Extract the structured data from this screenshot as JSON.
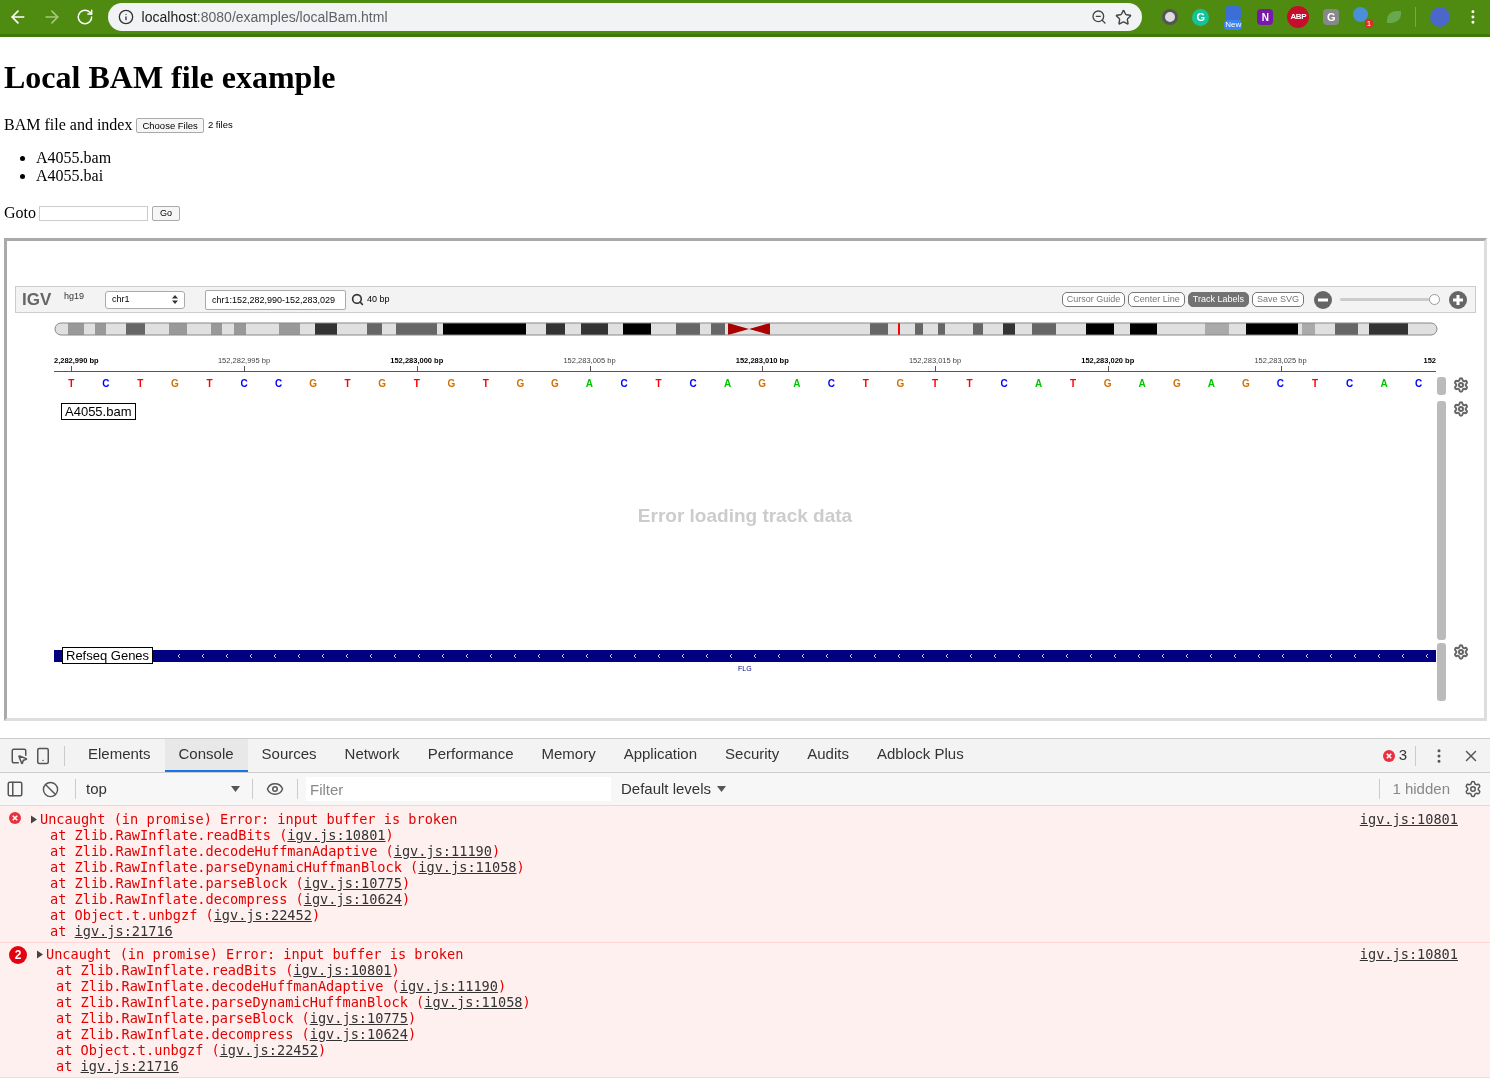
{
  "browser": {
    "url_host": "localhost",
    "url_path": ":8080/examples/localBam.html",
    "extensions": [
      {
        "kind": "record"
      },
      {
        "kind": "grammarly",
        "label": "G"
      },
      {
        "kind": "feed",
        "label": "New"
      },
      {
        "kind": "onenote",
        "label": "N"
      },
      {
        "kind": "adblock",
        "label": "ABP"
      },
      {
        "kind": "gsquare",
        "label": "G"
      },
      {
        "kind": "globe",
        "label": "1"
      },
      {
        "kind": "leaf"
      }
    ]
  },
  "heading": "Local BAM file example",
  "file_input": {
    "label": "BAM file and index",
    "button": "Choose Files",
    "status": "2 files"
  },
  "files": [
    "A4055.bam",
    "A4055.bai"
  ],
  "goto": {
    "label": "Goto",
    "button": "Go"
  },
  "igv": {
    "logo": "IGV",
    "genome": "hg19",
    "chromosome": "chr1",
    "locus": "chr1:152,282,990-152,283,029",
    "width": "40 bp",
    "buttons": [
      {
        "label": "Cursor Guide",
        "selected": false
      },
      {
        "label": "Center Line",
        "selected": false
      },
      {
        "label": "Track Labels",
        "selected": true
      },
      {
        "label": "Save SVG",
        "selected": false
      }
    ],
    "zoom": {
      "level": 1
    },
    "ruler": [
      {
        "label": "2,282,990 bp",
        "major": true
      },
      {
        "label": "152,282,995 bp",
        "major": false
      },
      {
        "label": "152,283,000 bp",
        "major": true
      },
      {
        "label": "152,283,005 bp",
        "major": false
      },
      {
        "label": "152,283,010 bp",
        "major": true
      },
      {
        "label": "152,283,015 bp",
        "major": false
      },
      {
        "label": "152,283,020 bp",
        "major": true
      },
      {
        "label": "152,283,025 bp",
        "major": false
      },
      {
        "label": "152",
        "major": true
      }
    ],
    "sequence": [
      {
        "base": "T",
        "color": "#ff0000"
      },
      {
        "base": "C",
        "color": "#0000ff"
      },
      {
        "base": "T",
        "color": "#ff0000"
      },
      {
        "base": "G",
        "color": "#d17105"
      },
      {
        "base": "T",
        "color": "#ff0000"
      },
      {
        "base": "C",
        "color": "#0000ff"
      },
      {
        "base": "C",
        "color": "#0000ff"
      },
      {
        "base": "G",
        "color": "#d17105"
      },
      {
        "base": "T",
        "color": "#ff0000"
      },
      {
        "base": "G",
        "color": "#d17105"
      },
      {
        "base": "T",
        "color": "#ff0000"
      },
      {
        "base": "G",
        "color": "#d17105"
      },
      {
        "base": "T",
        "color": "#ff0000"
      },
      {
        "base": "G",
        "color": "#d17105"
      },
      {
        "base": "G",
        "color": "#d17105"
      },
      {
        "base": "A",
        "color": "#00c800"
      },
      {
        "base": "C",
        "color": "#0000ff"
      },
      {
        "base": "T",
        "color": "#ff0000"
      },
      {
        "base": "C",
        "color": "#0000ff"
      },
      {
        "base": "A",
        "color": "#00c800"
      },
      {
        "base": "G",
        "color": "#d17105"
      },
      {
        "base": "A",
        "color": "#00c800"
      },
      {
        "base": "C",
        "color": "#0000ff"
      },
      {
        "base": "T",
        "color": "#ff0000"
      },
      {
        "base": "G",
        "color": "#d17105"
      },
      {
        "base": "T",
        "color": "#ff0000"
      },
      {
        "base": "T",
        "color": "#ff0000"
      },
      {
        "base": "C",
        "color": "#0000ff"
      },
      {
        "base": "A",
        "color": "#00c800"
      },
      {
        "base": "T",
        "color": "#ff0000"
      },
      {
        "base": "G",
        "color": "#d17105"
      },
      {
        "base": "A",
        "color": "#00c800"
      },
      {
        "base": "G",
        "color": "#d17105"
      },
      {
        "base": "A",
        "color": "#00c800"
      },
      {
        "base": "G",
        "color": "#d17105"
      },
      {
        "base": "C",
        "color": "#0000ff"
      },
      {
        "base": "T",
        "color": "#ff0000"
      },
      {
        "base": "C",
        "color": "#0000ff"
      },
      {
        "base": "A",
        "color": "#00c800"
      },
      {
        "base": "C",
        "color": "#0000ff"
      }
    ],
    "tracks": [
      {
        "kind": "alignment",
        "label": "A4055.bam",
        "message": "Error loading track data"
      },
      {
        "kind": "gene",
        "label": "Refseq Genes",
        "gene": "FLG"
      }
    ]
  },
  "devtools": {
    "tabs": [
      {
        "label": "Elements",
        "selected": false
      },
      {
        "label": "Console",
        "selected": true
      },
      {
        "label": "Sources",
        "selected": false
      },
      {
        "label": "Network",
        "selected": false
      },
      {
        "label": "Performance",
        "selected": false
      },
      {
        "label": "Memory",
        "selected": false
      },
      {
        "label": "Application",
        "selected": false
      },
      {
        "label": "Security",
        "selected": false
      },
      {
        "label": "Audits",
        "selected": false
      },
      {
        "label": "Adblock Plus",
        "selected": false
      }
    ],
    "error_count": "3",
    "context": "top",
    "filter_placeholder": "Filter",
    "levels": "Default levels",
    "hidden": "1 hidden",
    "messages": [
      {
        "kind": "error",
        "message": "Uncaught (in promise) Error: input buffer is broken",
        "source": "igv.js:10801",
        "frames": [
          {
            "before": "at Zlib.RawInflate.readBits (",
            "link": "igv.js:10801",
            "after": ")"
          },
          {
            "before": "at Zlib.RawInflate.decodeHuffmanAdaptive (",
            "link": "igv.js:11190",
            "after": ")"
          },
          {
            "before": "at Zlib.RawInflate.parseDynamicHuffmanBlock (",
            "link": "igv.js:11058",
            "after": ")"
          },
          {
            "before": "at Zlib.RawInflate.parseBlock (",
            "link": "igv.js:10775",
            "after": ")"
          },
          {
            "before": "at Zlib.RawInflate.decompress (",
            "link": "igv.js:10624",
            "after": ")"
          },
          {
            "before": "at Object.t.unbgzf (",
            "link": "igv.js:22452",
            "after": ")"
          },
          {
            "before": "at ",
            "link": "igv.js:21716"
          }
        ]
      },
      {
        "kind": "repeated",
        "count": "2",
        "message": "Uncaught (in promise) Error: input buffer is broken",
        "source": "igv.js:10801",
        "frames": [
          {
            "before": "at Zlib.RawInflate.readBits (",
            "link": "igv.js:10801",
            "after": ")"
          },
          {
            "before": "at Zlib.RawInflate.decodeHuffmanAdaptive (",
            "link": "igv.js:11190",
            "after": ")"
          },
          {
            "before": "at Zlib.RawInflate.parseDynamicHuffmanBlock (",
            "link": "igv.js:11058",
            "after": ")"
          },
          {
            "before": "at Zlib.RawInflate.parseBlock (",
            "link": "igv.js:10775",
            "after": ")"
          },
          {
            "before": "at Zlib.RawInflate.decompress (",
            "link": "igv.js:10624",
            "after": ")"
          },
          {
            "before": "at Object.t.unbgzf (",
            "link": "igv.js:22452",
            "after": ")"
          },
          {
            "before": "at ",
            "link": "igv.js:21716"
          }
        ]
      }
    ]
  }
}
